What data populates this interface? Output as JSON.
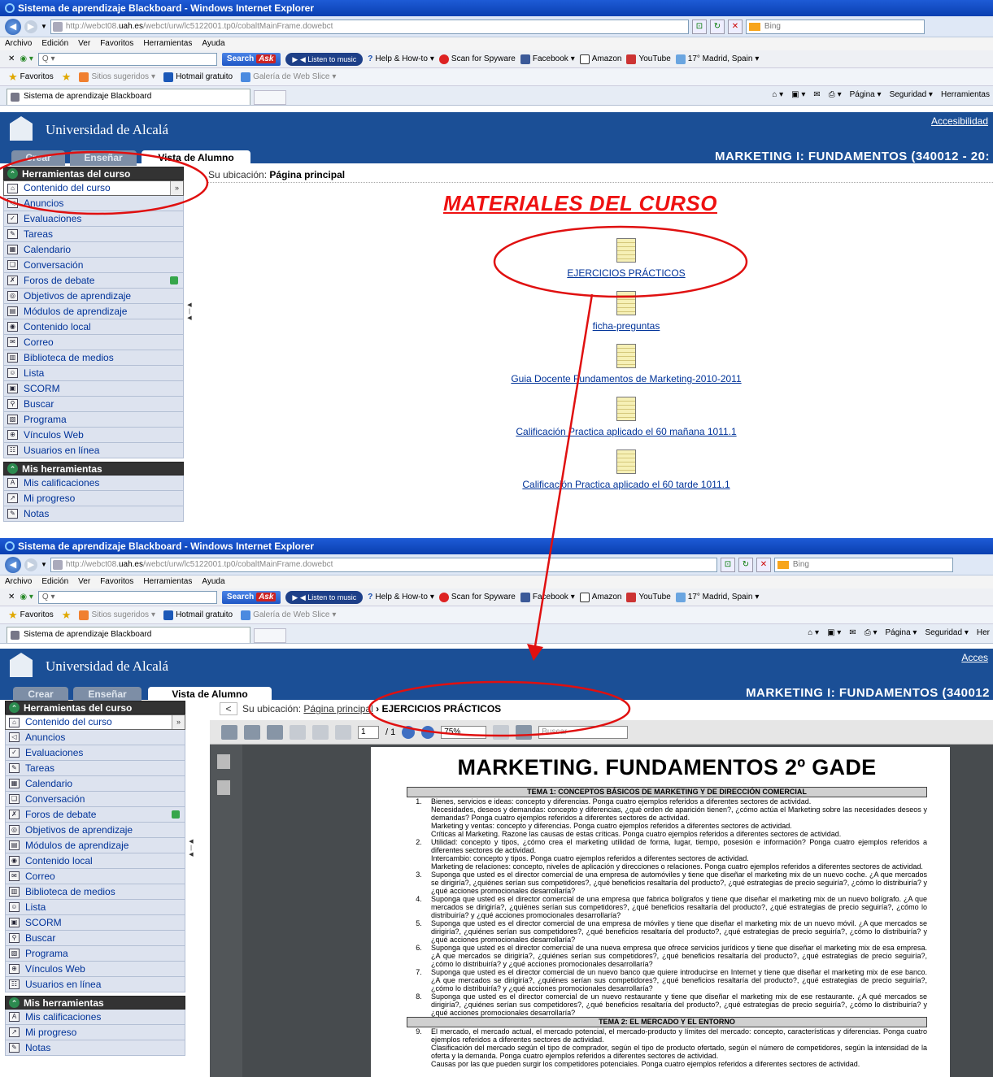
{
  "browser": {
    "window_title": "Sistema de aprendizaje Blackboard - Windows Internet Explorer",
    "url_prefix": "http://webct08.",
    "url_host": "uah.es",
    "url_path": "/webct/urw/lc5122001.tp0/cobaltMainFrame.dowebct",
    "search_engine": "Bing",
    "menu": [
      "Archivo",
      "Edición",
      "Ver",
      "Favoritos",
      "Herramientas",
      "Ayuda"
    ],
    "toolbar": {
      "search_label": "Search",
      "ask": "Ask",
      "listen": "Listen to music",
      "howto": "Help & How-to",
      "spyware": "Scan for Spyware",
      "facebook": "Facebook",
      "amazon": "Amazon",
      "youtube": "YouTube",
      "weather": "17° Madrid, Spain"
    },
    "favorites": {
      "label": "Favoritos",
      "suggested": "Sitios sugeridos",
      "hotmail": "Hotmail gratuito",
      "webslice": "Galería de Web Slice"
    },
    "tab_title": "Sistema de aprendizaje Blackboard",
    "commands": [
      "Página",
      "Seguridad",
      "Herramientas"
    ],
    "commands_short": [
      "Página",
      "Seguridad",
      "Her"
    ]
  },
  "bb": {
    "university": "Universidad de Alcalá",
    "accessibility": "Accesibilidad",
    "accessibility_short": "Acces",
    "tabs": [
      "Crear",
      "Enseñar",
      "Vista de Alumno"
    ],
    "course_title_1": "MARKETING I: FUNDAMENTOS (340012 - 20:",
    "course_title_2": "MARKETING I: FUNDAMENTOS (340012",
    "course_tools_header": "Herramientas del curso",
    "course_tools": [
      "Anuncios",
      "Evaluaciones",
      "Tareas",
      "Calendario",
      "Conversación",
      "Foros de debate",
      "Objetivos de aprendizaje",
      "Módulos de aprendizaje",
      "Contenido local",
      "Correo",
      "Biblioteca de medios",
      "Lista",
      "SCORM",
      "Buscar",
      "Programa",
      "Vínculos Web",
      "Usuarios en línea"
    ],
    "selected_tool": "Contenido del curso",
    "my_tools_header": "Mis herramientas",
    "my_tools": [
      "Mis calificaciones",
      "Mi progreso",
      "Notas"
    ]
  },
  "page1": {
    "location_label": "Su ubicación:",
    "location": "Página principal",
    "heading": "MATERIALES DEL CURSO",
    "documents": [
      "EJERCICIOS PRÁCTICOS",
      "ficha-preguntas",
      "Guia Docente Fundamentos de Marketing-2010-2011",
      "Calificación Practica aplicado el 60 mañana 1011.1",
      "Calificación Practica aplicado el 60 tarde 1011.1"
    ]
  },
  "page2": {
    "back": "<",
    "location_label": "Su ubicación:",
    "location_link": "Página principal",
    "separator": "›",
    "location_current": "EJERCICIOS PRÁCTICOS",
    "pdf": {
      "page_current": "1",
      "page_total": "/ 1",
      "zoom": "75%",
      "search_placeholder": "Buscar",
      "title": "MARKETING. FUNDAMENTOS 2º GADE",
      "theme1": "TEMA 1: CONCEPTOS BÁSICOS DE MARKETING Y DE DIRECCIÓN COMERCIAL",
      "theme2": "TEMA 2: EL MERCADO Y EL ENTORNO",
      "questions_t1": [
        {
          "n": "1.",
          "lines": [
            "Bienes, servicios e ideas: concepto y diferencias. Ponga cuatro ejemplos referidos a diferentes sectores de actividad.",
            "Necesidades, deseos y demandas: concepto y diferencias, ¿qué orden de aparición tienen?, ¿cómo actúa el Marketing sobre las necesidades deseos y demandas? Ponga cuatro ejemplos referidos a diferentes sectores de actividad.",
            "Marketing y ventas: concepto y diferencias. Ponga cuatro ejemplos referidos a diferentes sectores de actividad.",
            "Críticas al Marketing. Razone las causas de estas críticas. Ponga cuatro ejemplos referidos a diferentes sectores de actividad."
          ]
        },
        {
          "n": "2.",
          "lines": [
            "Utilidad: concepto y tipos, ¿cómo crea el marketing utilidad de forma, lugar, tiempo, posesión e información? Ponga cuatro ejemplos referidos a diferentes sectores de actividad.",
            "Intercambio: concepto y tipos. Ponga cuatro ejemplos referidos a diferentes sectores de actividad.",
            "Marketing de relaciones: concepto, niveles de aplicación y direcciones o relaciones. Ponga cuatro ejemplos referidos a diferentes sectores de actividad."
          ]
        },
        {
          "n": "3.",
          "lines": [
            "Suponga que usted es el director comercial de una empresa de automóviles y tiene que diseñar el marketing mix de un nuevo coche. ¿A que mercados se dirigiría?, ¿quiénes serían sus competidores?, ¿qué beneficios resaltaría del producto?, ¿qué estrategias de precio seguiría?, ¿cómo lo distribuiría? y ¿qué acciones promocionales desarrollaría?"
          ]
        },
        {
          "n": "4.",
          "lines": [
            "Suponga que usted es el director comercial de una empresa que fabrica bolígrafos y tiene que diseñar el marketing mix de un nuevo bolígrafo. ¿A que mercados se dirigiría?, ¿quiénes serían sus competidores?, ¿qué beneficios resaltaría del producto?, ¿qué estrategias de precio seguiría?, ¿cómo lo distribuiría? y ¿qué acciones promocionales desarrollaría?"
          ]
        },
        {
          "n": "5.",
          "lines": [
            "Suponga que usted es el director comercial de una empresa de móviles y tiene que diseñar el marketing mix de un nuevo móvil. ¿A que mercados se dirigiría?, ¿quiénes serían sus competidores?, ¿qué beneficios resaltaría del producto?, ¿qué estrategias de precio seguiría?, ¿cómo lo distribuiría? y ¿qué acciones promocionales desarrollaría?"
          ]
        },
        {
          "n": "6.",
          "lines": [
            "Suponga que usted es el director comercial de una nueva empresa que ofrece servicios jurídicos y tiene que diseñar el marketing mix de esa empresa. ¿A que mercados se dirigiría?, ¿quiénes serían sus competidores?, ¿qué beneficios resaltaría del producto?, ¿qué estrategias de precio seguiría?, ¿cómo lo distribuiría? y ¿qué acciones promocionales desarrollaría?"
          ]
        },
        {
          "n": "7.",
          "lines": [
            "Suponga que usted es el director comercial de un nuevo banco que quiere introducirse en Internet y tiene que diseñar el marketing mix de ese banco. ¿A que mercados se dirigiría?, ¿quiénes serían sus competidores?, ¿qué beneficios resaltaría del producto?, ¿qué estrategias de precio seguiría?, ¿cómo lo distribuiría? y ¿qué acciones promocionales desarrollaría?"
          ]
        },
        {
          "n": "8.",
          "lines": [
            "Suponga que usted es el director comercial de un nuevo restaurante y tiene que diseñar el marketing mix de ese restaurante. ¿A qué mercados se dirigiría?, ¿quiénes serían sus competidores?, ¿qué beneficios resaltaría del producto?, ¿qué estrategias de precio seguiría?, ¿cómo lo distribuiría? y ¿qué acciones promocionales desarrollaría?"
          ]
        }
      ],
      "questions_t2": [
        {
          "n": "9.",
          "lines": [
            "El mercado, el mercado actual, el mercado potencial, el mercado-producto y límites del mercado: concepto, características y diferencias. Ponga cuatro ejemplos referidos a diferentes sectores de actividad.",
            "Clasificación del mercado según el tipo de comprador, según el tipo de producto ofertado, según el número de competidores, según la intensidad de la oferta y la demanda. Ponga cuatro ejemplos referidos a diferentes sectores de actividad.",
            "Causas por las que pueden surgir los competidores potenciales. Ponga cuatro ejemplos referidos a diferentes sectores de actividad."
          ]
        }
      ]
    }
  },
  "annotations": {
    "color": "#e01010"
  }
}
